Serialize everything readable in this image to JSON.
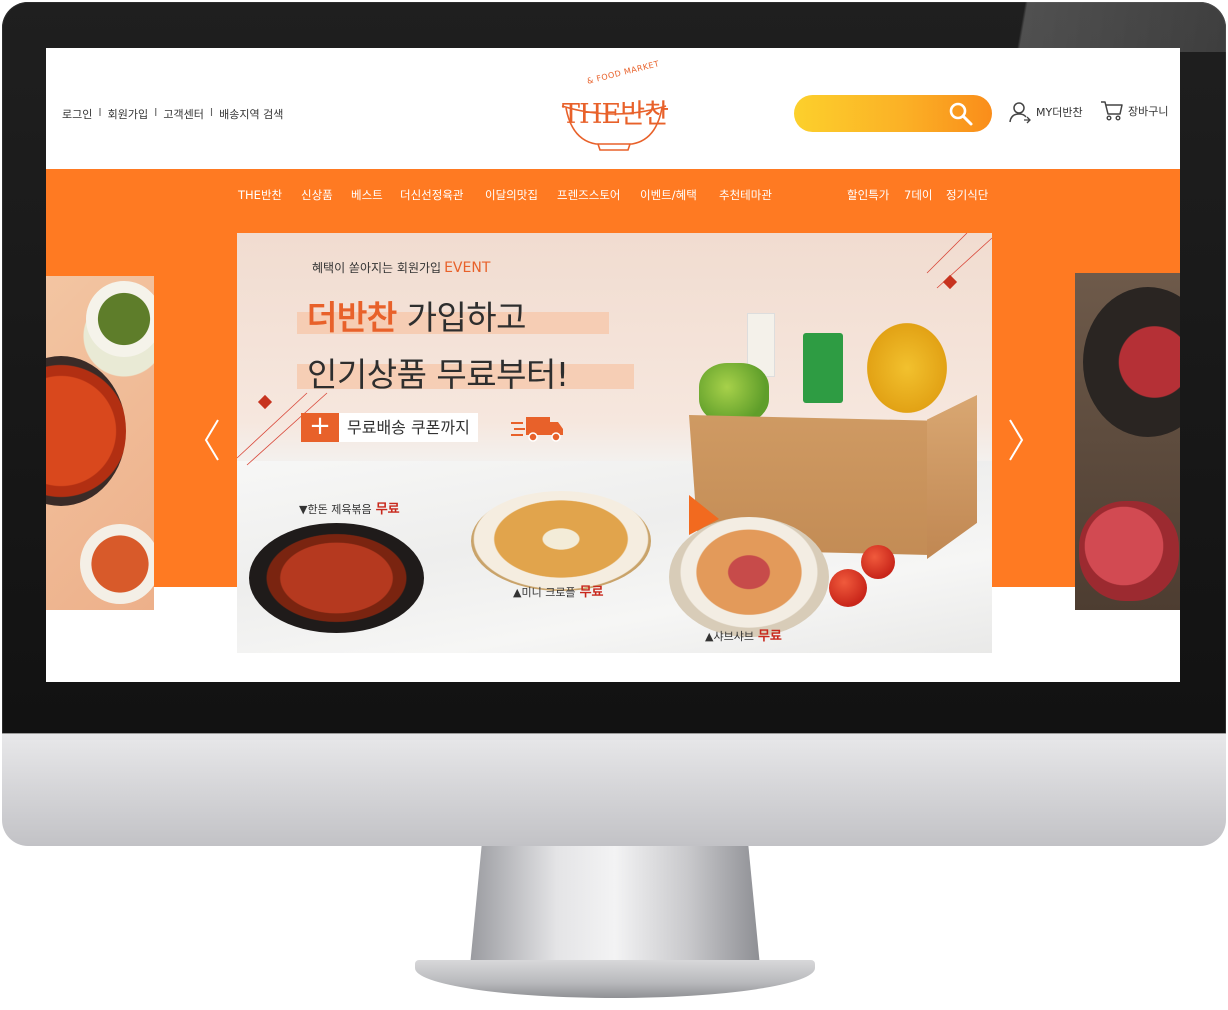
{
  "header": {
    "top_links": [
      "로그인",
      "회원가입",
      "고객센터",
      "배송지역 검색"
    ],
    "separator": "I",
    "logo_sub": "& FOOD MARKET",
    "logo_main": "THE반찬",
    "my_label": "MY더반찬",
    "cart_label": "장바구니"
  },
  "nav": {
    "items": [
      "THE반찬",
      "신상품",
      "베스트",
      "더신선정육관",
      "이달의맛집",
      "프렌즈스토어",
      "이벤트/혜택",
      "추천테마관"
    ],
    "right_items": [
      "할인특가",
      "7데이",
      "정기식단"
    ]
  },
  "banner": {
    "event_prefix": "혜택이 쏟아지는 회원가입",
    "event_word": "EVENT",
    "headline1_accent": "더반찬",
    "headline1_rest": " 가입하고",
    "headline2": "인기상품 무료부터!",
    "coupon_plus": "+",
    "coupon_text": "무료배송 쿠폰까지",
    "items": [
      {
        "label": "▼한돈 제육볶음",
        "tag": "무료"
      },
      {
        "label": "▲미니 크로플",
        "tag": "무료"
      },
      {
        "label": "▲샤브샤브",
        "tag": "무료"
      }
    ]
  },
  "colors": {
    "brand_orange": "#ff7a22",
    "logo_orange": "#e8612a",
    "free_red": "#c8281c",
    "search_yellow": "#fcd02c"
  },
  "icons": [
    "search-icon",
    "user-icon",
    "cart-icon",
    "chevron-left-icon",
    "chevron-right-icon",
    "truck-icon"
  ]
}
